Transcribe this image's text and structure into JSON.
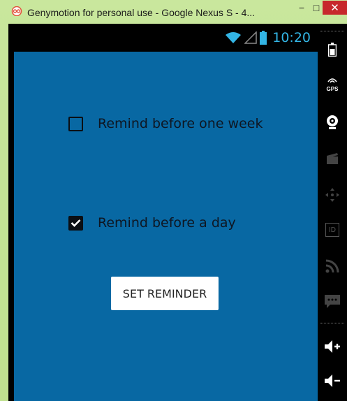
{
  "window": {
    "title": "Genymotion for personal use - Google Nexus S - 4...",
    "minimize": "−",
    "maximize": "□",
    "close": "✕",
    "icon": "genymotion-icon"
  },
  "statusbar": {
    "time": "10:20",
    "icons": [
      "wifi-icon",
      "signal-icon",
      "battery-icon"
    ],
    "accent": "#33b5e5"
  },
  "app": {
    "background": "#0868a3",
    "checkbox_week": {
      "label": "Remind before one week",
      "checked": false
    },
    "checkbox_day": {
      "label": "Remind before a day",
      "checked": true
    },
    "set_button": "SET REMINDER"
  },
  "panel": {
    "tools": [
      "battery-icon",
      "gps-icon",
      "webcam-icon",
      "screencast-icon",
      "dpad-icon",
      "id-icon",
      "rss-icon",
      "sms-icon",
      "volume-up-icon",
      "volume-down-icon"
    ],
    "gps_label": "GPS",
    "id_label": "ID"
  }
}
